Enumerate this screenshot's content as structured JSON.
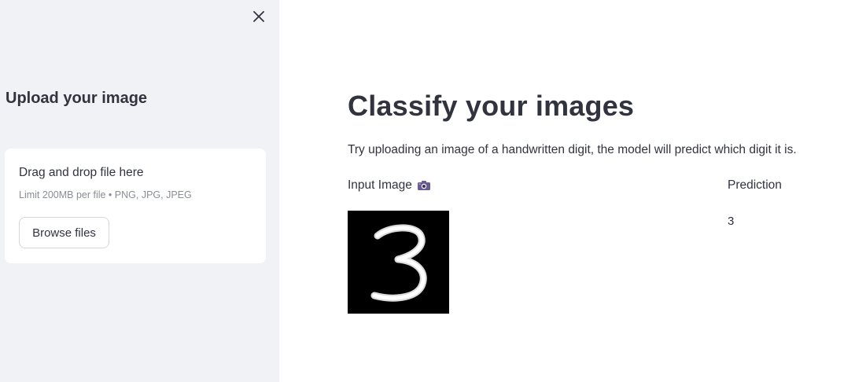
{
  "sidebar": {
    "close_icon": "close-icon",
    "heading": "Upload your image",
    "uploader": {
      "title": "Drag and drop file here",
      "limit": "Limit 200MB per file • PNG, JPG, JPEG",
      "browse_label": "Browse files"
    }
  },
  "main": {
    "title": "Classify your images",
    "description": "Try uploading an image of a handwritten digit, the model will predict which digit it is.",
    "columns": {
      "input_label": "Input Image",
      "input_icon": "camera-icon",
      "prediction_label": "Prediction"
    },
    "input_image_icon": "handwritten-digit-image",
    "prediction_value": "3"
  },
  "colors": {
    "sidebar_bg": "#f0f2f6",
    "text": "#31333f",
    "muted_text": "#8a8d96",
    "image_bg": "#000000"
  }
}
